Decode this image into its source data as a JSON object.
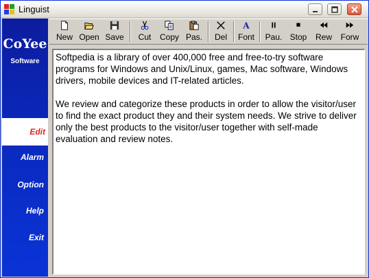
{
  "window": {
    "title": "Linguist"
  },
  "sidebar": {
    "brand": "CoYee",
    "brand_sub": "Software",
    "items": [
      {
        "label": "Edit",
        "active": true
      },
      {
        "label": "Alarm"
      },
      {
        "label": "Option"
      },
      {
        "label": "Help"
      },
      {
        "label": "Exit"
      }
    ]
  },
  "toolbar": {
    "buttons": [
      {
        "label": "New",
        "icon": "new-document-icon"
      },
      {
        "label": "Open",
        "icon": "open-folder-icon"
      },
      {
        "label": "Save",
        "icon": "floppy-disk-icon"
      },
      {
        "label": "Cut",
        "icon": "scissors-icon"
      },
      {
        "label": "Copy",
        "icon": "copy-icon"
      },
      {
        "label": "Pas.",
        "icon": "paste-clipboard-icon"
      },
      {
        "label": "Del",
        "icon": "delete-x-icon"
      },
      {
        "label": "Font",
        "icon": "font-a-icon"
      },
      {
        "label": "Pau.",
        "icon": "pause-icon"
      },
      {
        "label": "Stop",
        "icon": "stop-icon"
      },
      {
        "label": "Rew",
        "icon": "rewind-icon"
      },
      {
        "label": "Forw",
        "icon": "fast-forward-icon"
      }
    ]
  },
  "editor": {
    "paragraphs": [
      "Softpedia is a library of over 400,000 free and free-to-try software programs for Windows and Unix/Linux, games, Mac software, Windows drivers, mobile devices and IT-related articles.",
      "We review and categorize these products in order to allow the visitor/user to find the exact product they and their system needs. We strive to deliver only the best products to the visitor/user together with self-made evaluation and review notes."
    ]
  },
  "colors": {
    "sidebar": "#0a2ac0",
    "active_item_text": "#e0231c",
    "title_bar": "#f2f1ec"
  }
}
